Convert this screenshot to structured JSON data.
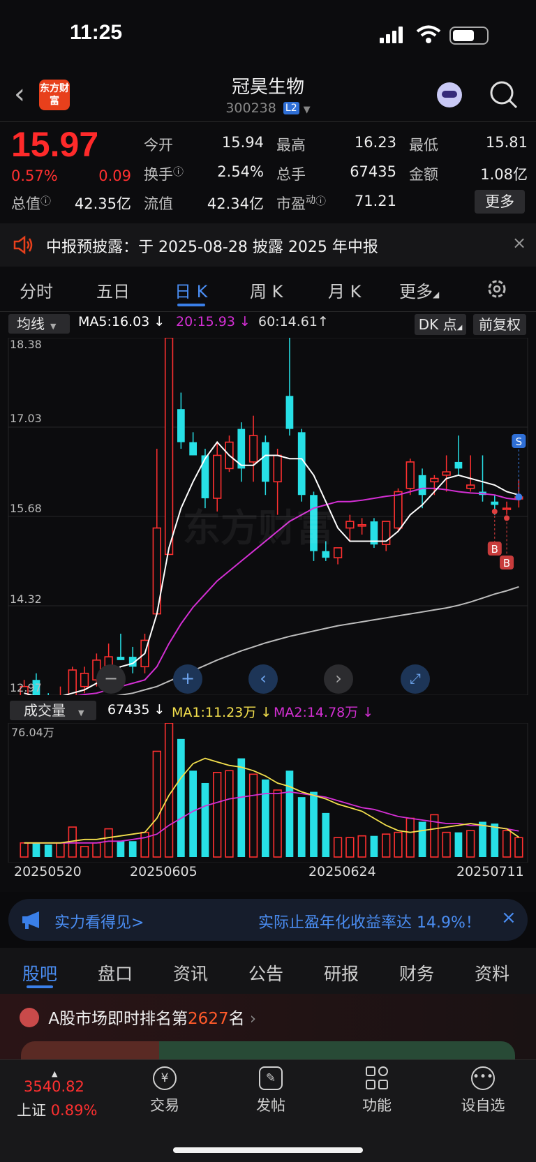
{
  "status": {
    "time": "11:25"
  },
  "header": {
    "stock_name": "冠昊生物",
    "stock_code": "300238",
    "level_badge": "L2",
    "logo_text": "东方财富"
  },
  "quote": {
    "price": "15.97",
    "change_pct": "0.57%",
    "change_amt": "0.09",
    "open_label": "今开",
    "open": "15.94",
    "high_label": "最高",
    "high": "16.23",
    "low_label": "最低",
    "low": "15.81",
    "turnover_label": "换手",
    "turnover": "2.54%",
    "volume_label": "总手",
    "volume": "67435",
    "amount_label": "金额",
    "amount": "1.08亿",
    "mktcap_label": "总值",
    "mktcap": "42.35亿",
    "float_label": "流值",
    "float": "42.34亿",
    "pe_label": "市盈",
    "pe_sup": "动",
    "pe": "71.21",
    "more_label": "更多"
  },
  "notice": {
    "text": "中报预披露：于 2025-08-28 披露 2025 年中报"
  },
  "chart_tabs": [
    "分时",
    "五日",
    "日 K",
    "周 K",
    "月 K",
    "更多"
  ],
  "ma_bar": {
    "selector": "均线",
    "ma5": "MA5:16.03",
    "ma20": "20:15.93",
    "ma60": "60:14.61",
    "dk": "DK 点",
    "adjust": "前复权"
  },
  "price_axis": [
    "18.38",
    "17.03",
    "15.68",
    "14.32",
    "12.97"
  ],
  "markers": {
    "buy": "B",
    "sell": "S"
  },
  "watermark": "东方财富",
  "volume_bar": {
    "selector": "成交量",
    "vol": "67435",
    "ma1": "MA1:11.23万",
    "ma2": "MA2:14.78万",
    "axis_max": "76.04万"
  },
  "date_axis": [
    "20250520",
    "20250605",
    "20250624",
    "20250711"
  ],
  "ad": {
    "left": "实力看得见>",
    "right": "实际止盈年化收益率达 14.9%！"
  },
  "bottom_tabs": [
    "股吧",
    "盘口",
    "资讯",
    "公告",
    "研报",
    "财务",
    "资料"
  ],
  "ranking": {
    "prefix": "A股市场即时排名第",
    "rank": "2627",
    "suffix": "名"
  },
  "index": {
    "value": "3540.82",
    "name": "上证",
    "pct": "0.89%"
  },
  "nav": [
    "交易",
    "发帖",
    "功能",
    "设自选"
  ],
  "colors": {
    "up": "#ff3030",
    "down": "#22d43a",
    "candle_down": "#27e0e6",
    "ma5": "#ffffff",
    "ma20": "#d42fd4",
    "ma60": "#bdbdbd",
    "vma1": "#f4e04d",
    "vma2": "#d42fd4",
    "accent": "#3a7fe8"
  },
  "chart_data": {
    "type": "candlestick",
    "y_range": [
      12.97,
      18.38
    ],
    "candles": [
      {
        "o": 12.9,
        "h": 13.2,
        "l": 12.8,
        "c": 13.1
      },
      {
        "o": 13.2,
        "h": 13.3,
        "l": 12.8,
        "c": 12.9
      },
      {
        "o": 12.9,
        "h": 13.0,
        "l": 12.75,
        "c": 12.8
      },
      {
        "o": 12.9,
        "h": 13.1,
        "l": 12.85,
        "c": 12.95
      },
      {
        "o": 12.95,
        "h": 13.4,
        "l": 12.9,
        "c": 13.35
      },
      {
        "o": 13.1,
        "h": 13.4,
        "l": 13.0,
        "c": 13.3
      },
      {
        "o": 13.2,
        "h": 13.6,
        "l": 13.1,
        "c": 13.5
      },
      {
        "o": 13.3,
        "h": 13.75,
        "l": 13.25,
        "c": 13.55
      },
      {
        "o": 13.55,
        "h": 13.9,
        "l": 13.5,
        "c": 13.5
      },
      {
        "o": 13.55,
        "h": 13.7,
        "l": 13.3,
        "c": 13.4
      },
      {
        "o": 13.4,
        "h": 13.9,
        "l": 13.3,
        "c": 13.8
      },
      {
        "o": 14.2,
        "h": 16.7,
        "l": 14.2,
        "c": 15.5
      },
      {
        "o": 15.1,
        "h": 18.38,
        "l": 15.1,
        "c": 18.38
      },
      {
        "o": 17.3,
        "h": 17.55,
        "l": 16.7,
        "c": 16.8
      },
      {
        "o": 16.8,
        "h": 16.95,
        "l": 16.6,
        "c": 16.6
      },
      {
        "o": 16.6,
        "h": 16.7,
        "l": 15.8,
        "c": 15.95
      },
      {
        "o": 15.95,
        "h": 16.8,
        "l": 15.75,
        "c": 16.6
      },
      {
        "o": 16.4,
        "h": 16.9,
        "l": 16.35,
        "c": 16.8
      },
      {
        "o": 17.0,
        "h": 17.1,
        "l": 16.2,
        "c": 16.4
      },
      {
        "o": 16.5,
        "h": 17.2,
        "l": 16.2,
        "c": 16.9
      },
      {
        "o": 16.8,
        "h": 16.9,
        "l": 16.0,
        "c": 16.2
      },
      {
        "o": 16.2,
        "h": 16.7,
        "l": 15.7,
        "c": 16.6
      },
      {
        "o": 17.5,
        "h": 18.38,
        "l": 16.9,
        "c": 17.0
      },
      {
        "o": 16.95,
        "h": 17.0,
        "l": 15.9,
        "c": 16.0
      },
      {
        "o": 16.0,
        "h": 16.05,
        "l": 15.0,
        "c": 15.15
      },
      {
        "o": 15.15,
        "h": 15.3,
        "l": 15.0,
        "c": 15.05
      },
      {
        "o": 15.05,
        "h": 15.2,
        "l": 14.95,
        "c": 15.2
      },
      {
        "o": 15.5,
        "h": 15.7,
        "l": 15.3,
        "c": 15.6
      },
      {
        "o": 15.55,
        "h": 15.65,
        "l": 15.4,
        "c": 15.55
      },
      {
        "o": 15.6,
        "h": 15.65,
        "l": 15.2,
        "c": 15.25
      },
      {
        "o": 15.25,
        "h": 15.6,
        "l": 15.15,
        "c": 15.6
      },
      {
        "o": 15.5,
        "h": 16.1,
        "l": 15.45,
        "c": 16.05
      },
      {
        "o": 16.1,
        "h": 16.55,
        "l": 16.0,
        "c": 16.5
      },
      {
        "o": 16.3,
        "h": 16.4,
        "l": 15.8,
        "c": 16.0
      },
      {
        "o": 16.2,
        "h": 16.3,
        "l": 16.0,
        "c": 16.25
      },
      {
        "o": 16.3,
        "h": 16.6,
        "l": 16.05,
        "c": 16.35
      },
      {
        "o": 16.5,
        "h": 16.9,
        "l": 16.3,
        "c": 16.4
      },
      {
        "o": 16.1,
        "h": 16.6,
        "l": 16.05,
        "c": 16.15
      },
      {
        "o": 16.05,
        "h": 16.6,
        "l": 15.9,
        "c": 16.0
      },
      {
        "o": 15.9,
        "h": 16.0,
        "l": 15.7,
        "c": 15.85
      },
      {
        "o": 15.8,
        "h": 15.9,
        "l": 15.7,
        "c": 15.8
      },
      {
        "o": 15.94,
        "h": 16.23,
        "l": 15.81,
        "c": 15.97
      }
    ],
    "ma5": [
      13.0,
      12.95,
      12.95,
      12.95,
      13.0,
      13.05,
      13.15,
      13.3,
      13.4,
      13.45,
      13.6,
      14.2,
      15.2,
      15.8,
      16.2,
      16.55,
      16.8,
      16.6,
      16.45,
      16.45,
      16.6,
      16.6,
      16.55,
      16.55,
      16.3,
      15.9,
      15.5,
      15.3,
      15.3,
      15.3,
      15.3,
      15.45,
      15.7,
      15.85,
      16.05,
      16.25,
      16.3,
      16.25,
      16.2,
      16.15,
      16.05,
      16.0
    ],
    "ma20": [
      12.9,
      12.9,
      12.9,
      12.92,
      12.95,
      12.98,
      13.0,
      13.05,
      13.1,
      13.15,
      13.2,
      13.4,
      13.75,
      14.05,
      14.3,
      14.5,
      14.7,
      14.85,
      15.0,
      15.15,
      15.3,
      15.45,
      15.6,
      15.7,
      15.8,
      15.85,
      15.9,
      15.9,
      15.92,
      15.95,
      15.98,
      16.0,
      16.05,
      16.1,
      16.1,
      16.08,
      16.05,
      16.03,
      16.02,
      16.0,
      15.95,
      15.93
    ],
    "ma60": [
      12.8,
      12.82,
      12.84,
      12.86,
      12.88,
      12.9,
      12.92,
      12.94,
      12.97,
      13.0,
      13.05,
      13.1,
      13.18,
      13.26,
      13.34,
      13.42,
      13.5,
      13.57,
      13.64,
      13.7,
      13.76,
      13.81,
      13.86,
      13.9,
      13.94,
      13.98,
      14.02,
      14.05,
      14.08,
      14.11,
      14.14,
      14.17,
      14.2,
      14.23,
      14.26,
      14.29,
      14.33,
      14.38,
      14.44,
      14.5,
      14.55,
      14.61
    ],
    "volume_max": 76.04,
    "volume": [
      8,
      8,
      7,
      8,
      17,
      6,
      8,
      16,
      9,
      9,
      14,
      60,
      76,
      67,
      49,
      42,
      48,
      49,
      56,
      47,
      44,
      38,
      49,
      34,
      37,
      25,
      11,
      11,
      12,
      12,
      13,
      14,
      22,
      20,
      24,
      14,
      14,
      15,
      20,
      19,
      15,
      11
    ],
    "vma1": [
      8,
      8,
      8,
      8,
      9,
      10,
      10,
      11,
      12,
      13,
      14,
      22,
      35,
      45,
      53,
      56,
      54,
      52,
      51,
      49,
      46,
      42,
      40,
      37,
      35,
      33,
      30,
      28,
      26,
      22,
      18,
      15,
      14,
      15,
      16,
      17,
      18,
      19,
      18,
      17,
      16,
      11.23
    ],
    "vma2": [
      8,
      8,
      8,
      8,
      8,
      8,
      8,
      9,
      9,
      10,
      11,
      13,
      18,
      22,
      26,
      29,
      31,
      33,
      34,
      35,
      36,
      36,
      37,
      36,
      35,
      34,
      32,
      30,
      28,
      27,
      25,
      23,
      22,
      21,
      20,
      19,
      19,
      18,
      18,
      17,
      16,
      14.78
    ]
  }
}
